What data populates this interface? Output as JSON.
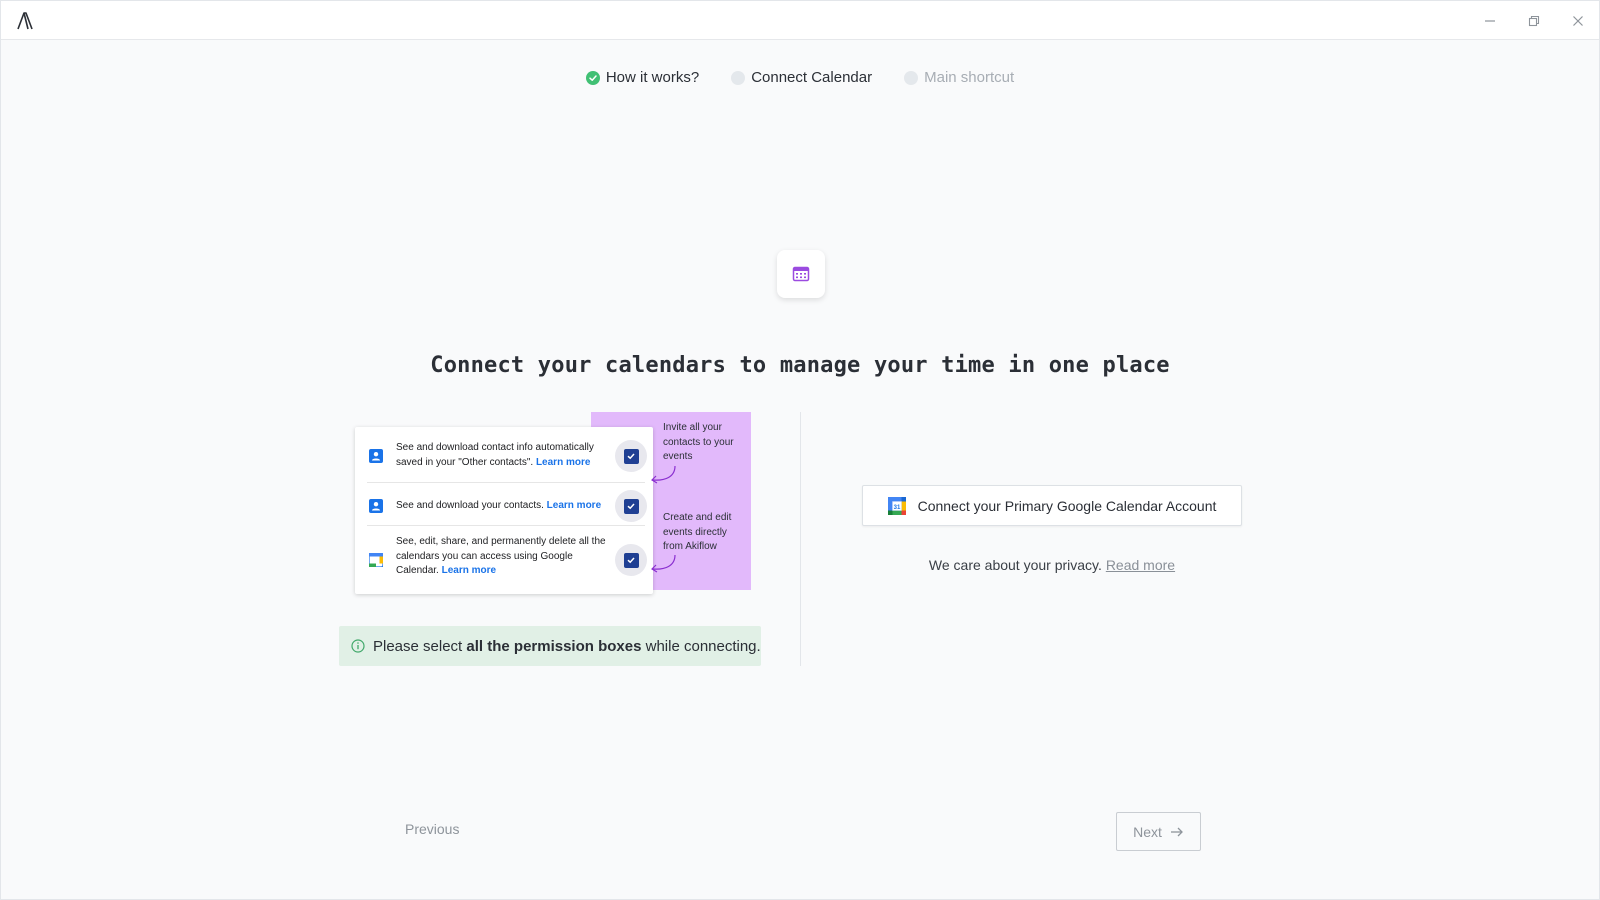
{
  "window": {
    "controls": {
      "minimize": "minimize-icon",
      "maximize": "restore-icon",
      "close": "close-icon"
    }
  },
  "stepper": {
    "steps": [
      {
        "label": "How it works?",
        "state": "done"
      },
      {
        "label": "Connect Calendar",
        "state": "active"
      },
      {
        "label": "Main shortcut",
        "state": "pending"
      }
    ]
  },
  "headline": "Connect your calendars to manage your time in one place",
  "illustration": {
    "permissions": [
      {
        "text": "See and download contact info automatically saved in your \"Other contacts\".",
        "link": "Learn more"
      },
      {
        "text": "See and download your contacts.",
        "link": "Learn more"
      },
      {
        "text": "See, edit, share, and permanently delete all the calendars you can access using Google Calendar.",
        "link": "Learn more"
      }
    ],
    "notes": [
      "Invite all your contacts to your events",
      "Create and edit events directly from Akiflow"
    ]
  },
  "info_banner": {
    "prefix": "Please select ",
    "bold": "all the permission boxes",
    "suffix": " while connecting."
  },
  "connect": {
    "button_label": "Connect your Primary Google Calendar Account"
  },
  "privacy": {
    "text": "We care about your privacy. ",
    "link": "Read more"
  },
  "nav": {
    "previous": "Previous",
    "next": "Next"
  },
  "colors": {
    "accent_purple": "#9b4be0",
    "success_green": "#41c074",
    "illustration_purple": "#e2b9fb",
    "banner_green": "#e1f0e6"
  }
}
